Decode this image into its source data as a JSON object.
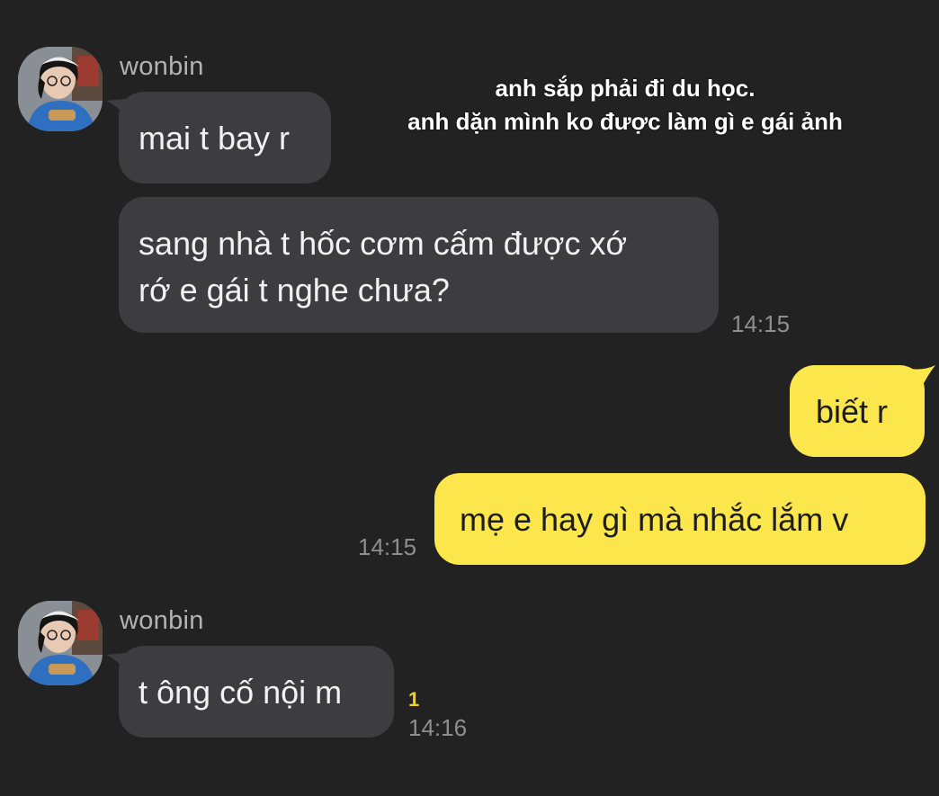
{
  "caption": {
    "line1": "anh sắp phải đi du học.",
    "line2": "anh dặn mình ko được làm gì e gái ảnh"
  },
  "contact": {
    "name": "wonbin"
  },
  "messages": [
    {
      "id": "m1",
      "side": "in",
      "text": "mai t bay r"
    },
    {
      "id": "m2",
      "side": "in",
      "lines": [
        "sang nhà t hốc cơm cấm được xớ",
        "rớ e gái t nghe chưa?"
      ],
      "time": "14:15"
    },
    {
      "id": "m3",
      "side": "out",
      "text": "biết r"
    },
    {
      "id": "m4",
      "side": "out",
      "text": "mẹ e hay gì mà nhắc lắm v",
      "time": "14:15"
    },
    {
      "id": "m5",
      "side": "in",
      "text": "t ông cố nội m",
      "unread": "1",
      "time": "14:16"
    }
  ],
  "colors": {
    "background": "#222223",
    "incoming_bubble": "#3d3d3f",
    "outgoing_bubble": "#fbe64b",
    "timestamp": "#8f8f8f",
    "unread_count": "#f2d21b"
  }
}
